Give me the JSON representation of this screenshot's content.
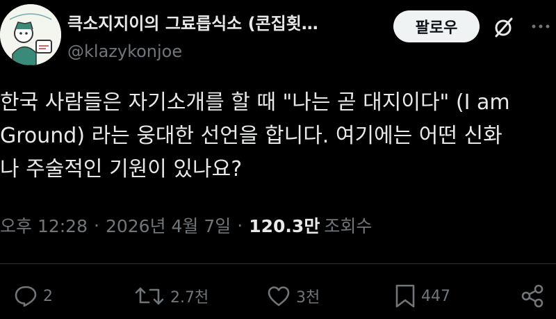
{
  "author": {
    "display_name": "큭소지지이의 그료릅식소 (콘집횟…",
    "handle": "@klazykonjoe",
    "avatar_icon": "avatar-illustration"
  },
  "header": {
    "follow_label": "팔로우",
    "grok_icon": "slashed-circle-icon",
    "more_icon": "more-dots-icon"
  },
  "tweet": {
    "text": "한국 사람들은 자기소개를 할 때 \"나는 곧 대지이다\" (I am\nGround) 라는 웅대한 선언을 합니다. 여기에는 어떤 신화\n나 주술적인 기원이 있나요?"
  },
  "meta": {
    "time": "오후 12:28",
    "separator": "·",
    "date": "2026년 4월 7일",
    "views_count": "120.3만",
    "views_label": "조회수"
  },
  "actions": {
    "replies": "2",
    "retweets": "2.7천",
    "likes": "3천",
    "bookmarks": "447"
  },
  "colors": {
    "background": "#000000",
    "primary_text": "#e7e9ea",
    "secondary_text": "#71767b",
    "follow_bg": "#eff3f4"
  }
}
